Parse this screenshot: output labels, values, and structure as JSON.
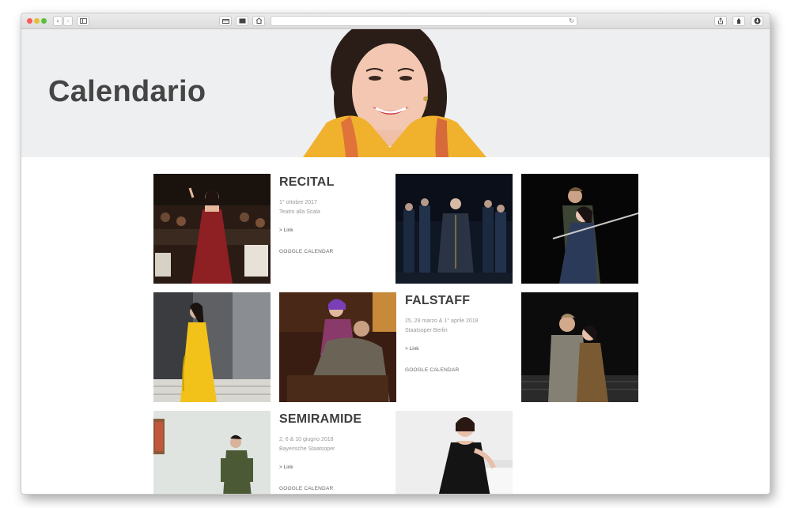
{
  "browser": {
    "back_icon": "chevron-left-icon",
    "forward_icon": "chevron-right-icon",
    "sidebar_icon": "sidebar-icon",
    "reload_icon": "reload-icon",
    "share_icon": "share-icon",
    "extension_icon": "extension-icon",
    "download_icon": "download-icon"
  },
  "hero": {
    "title": "Calendario"
  },
  "events": [
    {
      "title": "RECITAL",
      "date": "1° ottobre 2017",
      "venue": "Teatro alla Scala",
      "link": "> Link",
      "calendar": "GOOGLE CALENDAR"
    },
    {
      "title": "FALSTAFF",
      "date": "25, 28 marzo & 1° aprile 2018",
      "venue": "Staatsoper Berlin",
      "link": "> Link",
      "calendar": "GOOGLE CALENDAR"
    },
    {
      "title": "SEMIRAMIDE",
      "date": "2, 6 & 10 giugno 2018",
      "venue": "Bayerische Staatsoper",
      "link": "> Link",
      "calendar": "GOOGLE CALENDAR"
    }
  ],
  "colors": {
    "hero_bg": "#eeeff1",
    "title_text": "#454545",
    "muted_text": "#9a9a9a"
  }
}
